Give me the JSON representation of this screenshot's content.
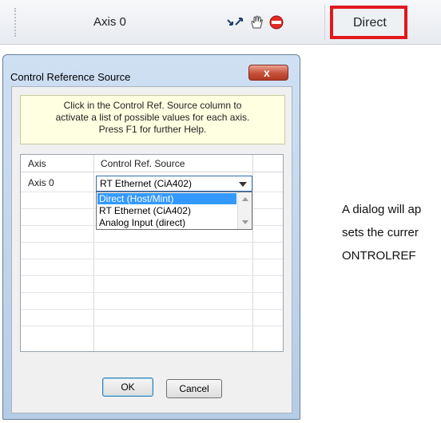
{
  "toolbar": {
    "axis_label": "Axis 0",
    "icons": [
      "move-arrows-icon",
      "hand-icon",
      "stop-icon"
    ],
    "control_ref_value": "Direct",
    "highlight_color": "#e0191f"
  },
  "dialog": {
    "title": "Control Reference Source",
    "close_label": "x",
    "info_lines": [
      "Click in the Control Ref. Source column to",
      "activate a list of possible values for each axis.",
      "Press F1 for further Help."
    ],
    "columns": [
      "Axis",
      "Control Ref.  Source"
    ],
    "rows": [
      {
        "axis": "Axis 0",
        "source": "RT Ethernet (CiA402)"
      }
    ],
    "dropdown_options": [
      "Direct (Host/Mint)",
      "RT Ethernet (CiA402)",
      "Analog Input (direct)"
    ],
    "selected_option_index": 0,
    "ok_label": "OK",
    "cancel_label": "Cancel"
  },
  "side_text_lines": [
    "A dialog will ap",
    "sets the currer",
    "ONTROLREF"
  ]
}
